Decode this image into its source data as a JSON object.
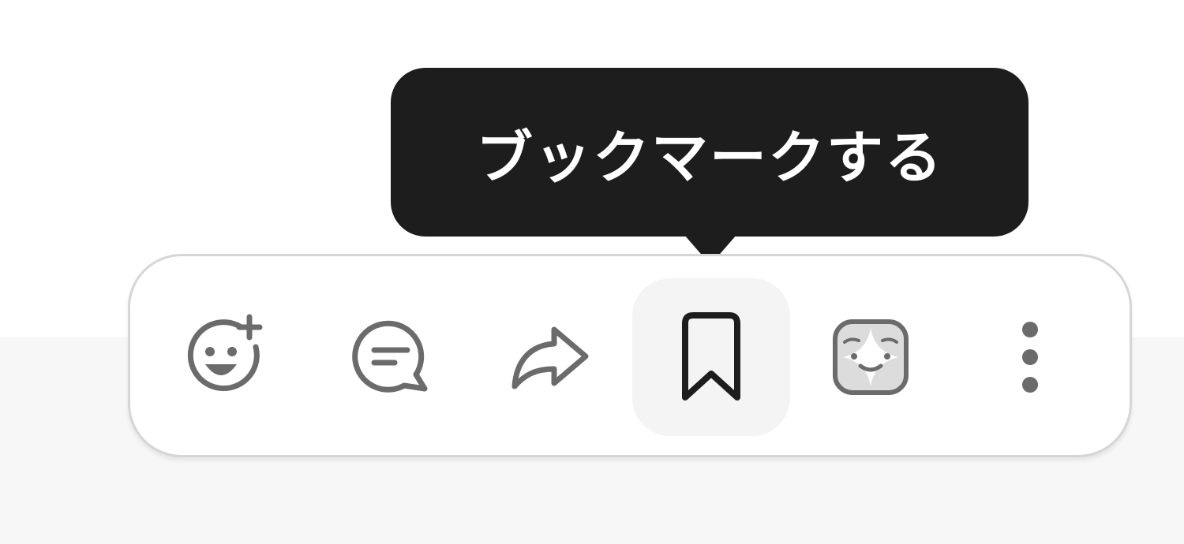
{
  "tooltip": {
    "text": "ブックマークする"
  },
  "toolbar": {
    "buttons": [
      {
        "name": "add-reaction",
        "icon": "emoji-plus-icon"
      },
      {
        "name": "reply",
        "icon": "speech-bubble-icon"
      },
      {
        "name": "share",
        "icon": "share-arrow-icon"
      },
      {
        "name": "bookmark",
        "icon": "bookmark-icon",
        "active": true
      },
      {
        "name": "app-action",
        "icon": "app-face-icon"
      },
      {
        "name": "more-actions",
        "icon": "vertical-dots-icon"
      }
    ]
  },
  "colors": {
    "tooltip_bg": "#1d1d1d",
    "icon": "#6b6b6b",
    "active_icon": "#1d1d1d",
    "active_bg": "#f4f4f4",
    "toolbar_border": "#d6d6d6",
    "page_bottom": "#f7f7f7"
  }
}
